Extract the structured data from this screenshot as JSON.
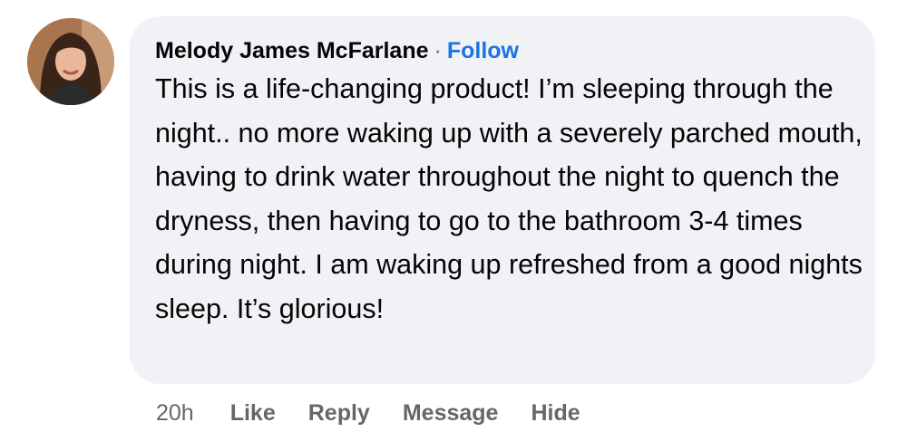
{
  "comment": {
    "author": "Melody James McFarlane",
    "separator": "·",
    "follow_label": "Follow",
    "text": "This is a life-changing product! I’m sleeping through the night.. no more waking up with a severely parched mouth, having to drink water throughout the night to quench the dryness, then having to go to the bathroom 3-4 times during night. I am waking up refreshed from a good nights sleep. It’s glorious!",
    "timestamp": "20h",
    "actions": {
      "like": "Like",
      "reply": "Reply",
      "message": "Message",
      "hide": "Hide"
    }
  },
  "colors": {
    "bubble_bg": "#f0f2f5",
    "link_blue": "#1b74e4",
    "meta_gray": "#65676b",
    "text": "#050505"
  }
}
